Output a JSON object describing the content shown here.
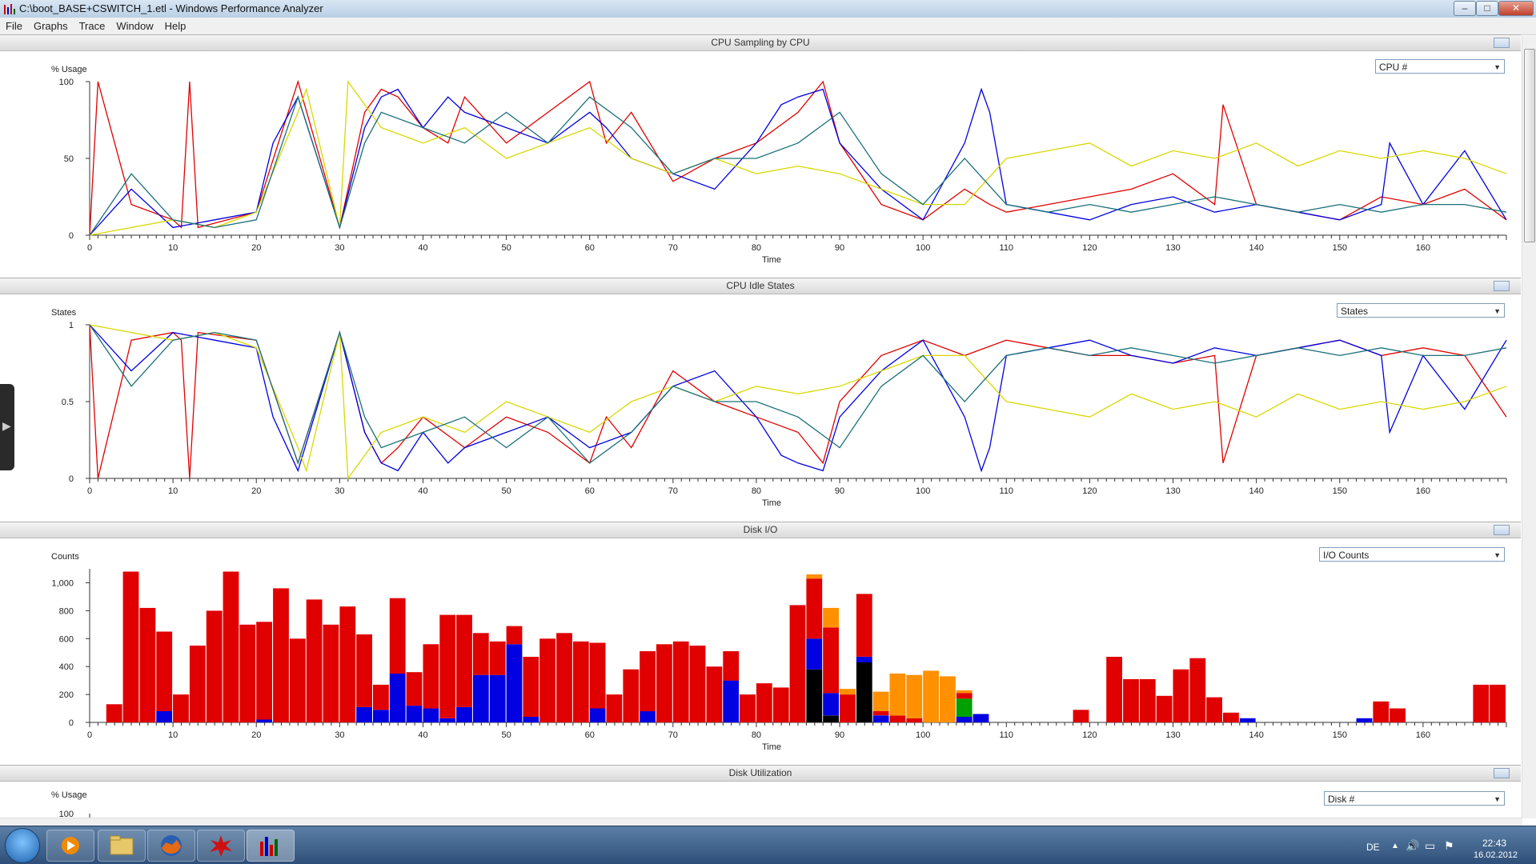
{
  "window": {
    "title": "C:\\boot_BASE+CSWITCH_1.etl - Windows Performance Analyzer",
    "minimize": "–",
    "maximize": "□",
    "close": "✕"
  },
  "menu": [
    "File",
    "Graphs",
    "Trace",
    "Window",
    "Help"
  ],
  "colors": {
    "red": "#e00000",
    "blue": "#0000e0",
    "yellow": "#d8d800",
    "teal": "#1a6f7a",
    "black": "#000000",
    "orange": "#ff9000",
    "green": "#00a000"
  },
  "panels": {
    "cpu_sampling": {
      "title": "CPU Sampling by CPU",
      "dropdown": "CPU #"
    },
    "cpu_idle": {
      "title": "CPU Idle States",
      "dropdown": "States"
    },
    "disk_io": {
      "title": "Disk I/O",
      "dropdown": "I/O Counts"
    },
    "disk_util": {
      "title": "Disk Utilization",
      "dropdown": "Disk #"
    }
  },
  "chart_data": [
    {
      "type": "line",
      "title": "CPU Sampling by CPU",
      "xlabel": "Time",
      "ylabel": "% Usage",
      "xlim": [
        0,
        170
      ],
      "ylim": [
        0,
        100
      ],
      "x_ticks": [
        0,
        10,
        20,
        30,
        40,
        50,
        60,
        70,
        80,
        90,
        100,
        110,
        120,
        130,
        140,
        150,
        160
      ],
      "y_ticks": [
        "0",
        "50",
        "100"
      ],
      "series": [
        {
          "color": "#e00000",
          "x": [
            0,
            1,
            5,
            10,
            11,
            12,
            13,
            20,
            25,
            30,
            33,
            35,
            37,
            40,
            43,
            45,
            50,
            55,
            60,
            62,
            65,
            70,
            75,
            80,
            85,
            88,
            90,
            95,
            100,
            105,
            108,
            110,
            115,
            120,
            125,
            130,
            135,
            136,
            140,
            145,
            150,
            155,
            160,
            165,
            170
          ],
          "values": [
            0,
            100,
            20,
            10,
            5,
            100,
            5,
            15,
            100,
            5,
            80,
            95,
            90,
            70,
            60,
            90,
            60,
            80,
            100,
            60,
            80,
            35,
            50,
            60,
            80,
            100,
            60,
            20,
            10,
            30,
            20,
            15,
            20,
            25,
            30,
            40,
            20,
            85,
            20,
            15,
            10,
            25,
            20,
            30,
            10
          ]
        },
        {
          "color": "#0000e0",
          "x": [
            0,
            5,
            10,
            15,
            20,
            22,
            25,
            30,
            33,
            35,
            37,
            40,
            43,
            45,
            50,
            55,
            60,
            62,
            65,
            70,
            75,
            80,
            83,
            85,
            88,
            90,
            95,
            100,
            105,
            107,
            108,
            110,
            115,
            120,
            125,
            130,
            135,
            140,
            145,
            150,
            155,
            156,
            160,
            165,
            170
          ],
          "values": [
            0,
            30,
            5,
            10,
            15,
            60,
            90,
            5,
            70,
            90,
            95,
            70,
            90,
            80,
            70,
            60,
            80,
            70,
            50,
            40,
            30,
            60,
            85,
            90,
            95,
            60,
            30,
            10,
            60,
            95,
            80,
            20,
            15,
            10,
            20,
            25,
            15,
            20,
            15,
            10,
            20,
            60,
            20,
            55,
            10
          ]
        },
        {
          "color": "#d8d800",
          "x": [
            0,
            5,
            10,
            15,
            20,
            25,
            26,
            30,
            31,
            33,
            35,
            40,
            45,
            50,
            55,
            60,
            65,
            70,
            75,
            80,
            85,
            90,
            95,
            100,
            105,
            110,
            115,
            120,
            125,
            130,
            135,
            140,
            145,
            150,
            155,
            160,
            165,
            170
          ],
          "values": [
            0,
            5,
            10,
            5,
            15,
            80,
            95,
            5,
            100,
            85,
            70,
            60,
            70,
            50,
            60,
            70,
            50,
            40,
            50,
            40,
            45,
            40,
            30,
            20,
            20,
            50,
            55,
            60,
            45,
            55,
            50,
            60,
            45,
            55,
            50,
            55,
            50,
            40
          ]
        },
        {
          "color": "#1a6f7a",
          "x": [
            0,
            5,
            10,
            15,
            20,
            25,
            30,
            33,
            35,
            40,
            45,
            50,
            55,
            60,
            65,
            70,
            75,
            80,
            85,
            90,
            95,
            100,
            105,
            110,
            115,
            120,
            125,
            130,
            135,
            140,
            145,
            150,
            155,
            160,
            165,
            170
          ],
          "values": [
            0,
            40,
            10,
            5,
            10,
            90,
            5,
            60,
            80,
            70,
            60,
            80,
            60,
            90,
            70,
            40,
            50,
            50,
            60,
            80,
            40,
            20,
            50,
            20,
            15,
            20,
            15,
            20,
            25,
            20,
            15,
            20,
            15,
            20,
            20,
            15
          ]
        }
      ]
    },
    {
      "type": "line",
      "title": "CPU Idle States",
      "xlabel": "Time",
      "ylabel": "States",
      "xlim": [
        0,
        170
      ],
      "ylim": [
        0,
        1
      ],
      "x_ticks": [
        0,
        10,
        20,
        30,
        40,
        50,
        60,
        70,
        80,
        90,
        100,
        110,
        120,
        130,
        140,
        150,
        160
      ],
      "y_ticks": [
        "0",
        "0.5",
        "1"
      ],
      "series": [
        {
          "color": "#e00000",
          "x": [
            0,
            1,
            5,
            10,
            11,
            12,
            13,
            20,
            25,
            30,
            33,
            35,
            37,
            40,
            45,
            50,
            55,
            60,
            62,
            65,
            70,
            75,
            80,
            85,
            88,
            90,
            95,
            100,
            105,
            110,
            115,
            120,
            125,
            130,
            135,
            136,
            140,
            145,
            150,
            155,
            160,
            165,
            170
          ],
          "values": [
            1,
            0,
            0.9,
            0.95,
            0.9,
            0,
            0.95,
            0.9,
            0.1,
            0.95,
            0.3,
            0.1,
            0.2,
            0.4,
            0.2,
            0.4,
            0.3,
            0.1,
            0.4,
            0.2,
            0.7,
            0.5,
            0.4,
            0.3,
            0.1,
            0.5,
            0.8,
            0.9,
            0.8,
            0.9,
            0.85,
            0.8,
            0.8,
            0.75,
            0.8,
            0.1,
            0.8,
            0.85,
            0.9,
            0.8,
            0.85,
            0.8,
            0.4
          ]
        },
        {
          "color": "#0000e0",
          "x": [
            0,
            5,
            10,
            15,
            20,
            22,
            25,
            30,
            33,
            35,
            37,
            40,
            43,
            45,
            50,
            55,
            60,
            65,
            70,
            75,
            80,
            83,
            85,
            88,
            90,
            95,
            100,
            105,
            107,
            108,
            110,
            115,
            120,
            125,
            130,
            135,
            140,
            145,
            150,
            155,
            156,
            160,
            165,
            170
          ],
          "values": [
            1,
            0.7,
            0.95,
            0.9,
            0.85,
            0.4,
            0.05,
            0.95,
            0.3,
            0.1,
            0.05,
            0.3,
            0.1,
            0.2,
            0.3,
            0.4,
            0.2,
            0.3,
            0.6,
            0.7,
            0.4,
            0.15,
            0.1,
            0.05,
            0.4,
            0.7,
            0.9,
            0.4,
            0.05,
            0.2,
            0.8,
            0.85,
            0.9,
            0.8,
            0.75,
            0.85,
            0.8,
            0.85,
            0.9,
            0.8,
            0.3,
            0.8,
            0.45,
            0.9
          ]
        },
        {
          "color": "#d8d800",
          "x": [
            0,
            5,
            10,
            15,
            20,
            25,
            26,
            30,
            31,
            33,
            35,
            40,
            45,
            50,
            55,
            60,
            65,
            70,
            75,
            80,
            85,
            90,
            95,
            100,
            105,
            110,
            115,
            120,
            125,
            130,
            135,
            140,
            145,
            150,
            155,
            160,
            165,
            170
          ],
          "values": [
            1,
            0.95,
            0.9,
            0.95,
            0.85,
            0.2,
            0.05,
            0.95,
            0,
            0.15,
            0.3,
            0.4,
            0.3,
            0.5,
            0.4,
            0.3,
            0.5,
            0.6,
            0.5,
            0.6,
            0.55,
            0.6,
            0.7,
            0.8,
            0.8,
            0.5,
            0.45,
            0.4,
            0.55,
            0.45,
            0.5,
            0.4,
            0.55,
            0.45,
            0.5,
            0.45,
            0.5,
            0.6
          ]
        },
        {
          "color": "#1a6f7a",
          "x": [
            0,
            5,
            10,
            15,
            20,
            25,
            30,
            33,
            35,
            40,
            45,
            50,
            55,
            60,
            65,
            70,
            75,
            80,
            85,
            90,
            95,
            100,
            105,
            110,
            115,
            120,
            125,
            130,
            135,
            140,
            145,
            150,
            155,
            160,
            165,
            170
          ],
          "values": [
            1,
            0.6,
            0.9,
            0.95,
            0.9,
            0.1,
            0.95,
            0.4,
            0.2,
            0.3,
            0.4,
            0.2,
            0.4,
            0.1,
            0.3,
            0.6,
            0.5,
            0.5,
            0.4,
            0.2,
            0.6,
            0.8,
            0.5,
            0.8,
            0.85,
            0.8,
            0.85,
            0.8,
            0.75,
            0.8,
            0.85,
            0.8,
            0.85,
            0.8,
            0.8,
            0.85
          ]
        }
      ]
    },
    {
      "type": "bar",
      "title": "Disk I/O",
      "xlabel": "Time",
      "ylabel": "Counts",
      "xlim": [
        0,
        170
      ],
      "ylim": [
        0,
        1100
      ],
      "x_ticks": [
        0,
        10,
        20,
        30,
        40,
        50,
        60,
        70,
        80,
        90,
        100,
        110,
        120,
        130,
        140,
        150,
        160
      ],
      "y_ticks": [
        "0",
        "200",
        "400",
        "600",
        "800",
        "1,000"
      ],
      "bar_width": 2,
      "bars": [
        {
          "x": 2,
          "red": 130,
          "blue": 0
        },
        {
          "x": 4,
          "red": 1080,
          "blue": 0
        },
        {
          "x": 6,
          "red": 820,
          "blue": 0
        },
        {
          "x": 8,
          "red": 570,
          "blue": 80
        },
        {
          "x": 10,
          "red": 200,
          "blue": 0
        },
        {
          "x": 12,
          "red": 550,
          "blue": 0
        },
        {
          "x": 14,
          "red": 800,
          "blue": 0
        },
        {
          "x": 16,
          "red": 1080,
          "blue": 0
        },
        {
          "x": 18,
          "red": 700,
          "blue": 0
        },
        {
          "x": 20,
          "red": 700,
          "blue": 20
        },
        {
          "x": 22,
          "red": 960,
          "blue": 0
        },
        {
          "x": 24,
          "red": 600,
          "blue": 0
        },
        {
          "x": 26,
          "red": 880,
          "blue": 0
        },
        {
          "x": 28,
          "red": 700,
          "blue": 0
        },
        {
          "x": 30,
          "red": 830,
          "blue": 0
        },
        {
          "x": 32,
          "red": 520,
          "blue": 110
        },
        {
          "x": 34,
          "red": 180,
          "blue": 90
        },
        {
          "x": 36,
          "red": 540,
          "blue": 350
        },
        {
          "x": 38,
          "red": 240,
          "blue": 120
        },
        {
          "x": 40,
          "red": 460,
          "blue": 100
        },
        {
          "x": 42,
          "red": 740,
          "blue": 30
        },
        {
          "x": 44,
          "red": 660,
          "blue": 110
        },
        {
          "x": 46,
          "red": 300,
          "blue": 340
        },
        {
          "x": 48,
          "red": 240,
          "blue": 340
        },
        {
          "x": 50,
          "red": 130,
          "blue": 560
        },
        {
          "x": 52,
          "red": 430,
          "blue": 40
        },
        {
          "x": 54,
          "red": 600,
          "blue": 0
        },
        {
          "x": 56,
          "red": 640,
          "blue": 0
        },
        {
          "x": 58,
          "red": 580,
          "blue": 0
        },
        {
          "x": 60,
          "red": 470,
          "blue": 100
        },
        {
          "x": 62,
          "red": 200,
          "blue": 0
        },
        {
          "x": 64,
          "red": 380,
          "blue": 0
        },
        {
          "x": 66,
          "red": 430,
          "blue": 80
        },
        {
          "x": 68,
          "red": 560,
          "blue": 0
        },
        {
          "x": 70,
          "red": 580,
          "blue": 0
        },
        {
          "x": 72,
          "red": 550,
          "blue": 0
        },
        {
          "x": 74,
          "red": 400,
          "blue": 0
        },
        {
          "x": 76,
          "red": 210,
          "blue": 300
        },
        {
          "x": 78,
          "red": 200,
          "blue": 0
        },
        {
          "x": 80,
          "red": 280,
          "blue": 0
        },
        {
          "x": 82,
          "red": 250,
          "blue": 0
        },
        {
          "x": 84,
          "red": 840,
          "blue": 0
        },
        {
          "x": 86,
          "red": 430,
          "blue": 220,
          "black": 380,
          "orange": 30
        },
        {
          "x": 88,
          "red": 470,
          "blue": 160,
          "black": 50,
          "orange": 140
        },
        {
          "x": 90,
          "red": 200,
          "orange": 40
        },
        {
          "x": 92,
          "red": 450,
          "blue": 40,
          "black": 430
        },
        {
          "x": 94,
          "red": 30,
          "blue": 50,
          "orange": 140
        },
        {
          "x": 96,
          "red": 50,
          "orange": 300
        },
        {
          "x": 98,
          "red": 30,
          "orange": 310
        },
        {
          "x": 100,
          "orange": 370
        },
        {
          "x": 102,
          "orange": 330
        },
        {
          "x": 104,
          "red": 40,
          "blue": 40,
          "green": 130,
          "orange": 20
        },
        {
          "x": 106,
          "blue": 60
        },
        {
          "x": 118,
          "red": 90
        },
        {
          "x": 122,
          "red": 470
        },
        {
          "x": 124,
          "red": 310
        },
        {
          "x": 126,
          "red": 310
        },
        {
          "x": 128,
          "red": 190
        },
        {
          "x": 130,
          "red": 380
        },
        {
          "x": 132,
          "red": 460
        },
        {
          "x": 134,
          "red": 180
        },
        {
          "x": 136,
          "red": 70
        },
        {
          "x": 138,
          "blue": 30
        },
        {
          "x": 152,
          "blue": 30
        },
        {
          "x": 154,
          "red": 150
        },
        {
          "x": 156,
          "red": 100
        },
        {
          "x": 166,
          "red": 270
        },
        {
          "x": 168,
          "red": 270
        }
      ]
    },
    {
      "type": "line",
      "title": "Disk Utilization",
      "ylabel": "% Usage",
      "y_ticks": [
        "100"
      ]
    }
  ],
  "taskbar": {
    "lang": "DE",
    "time": "22:43",
    "date": "16.02.2012"
  }
}
